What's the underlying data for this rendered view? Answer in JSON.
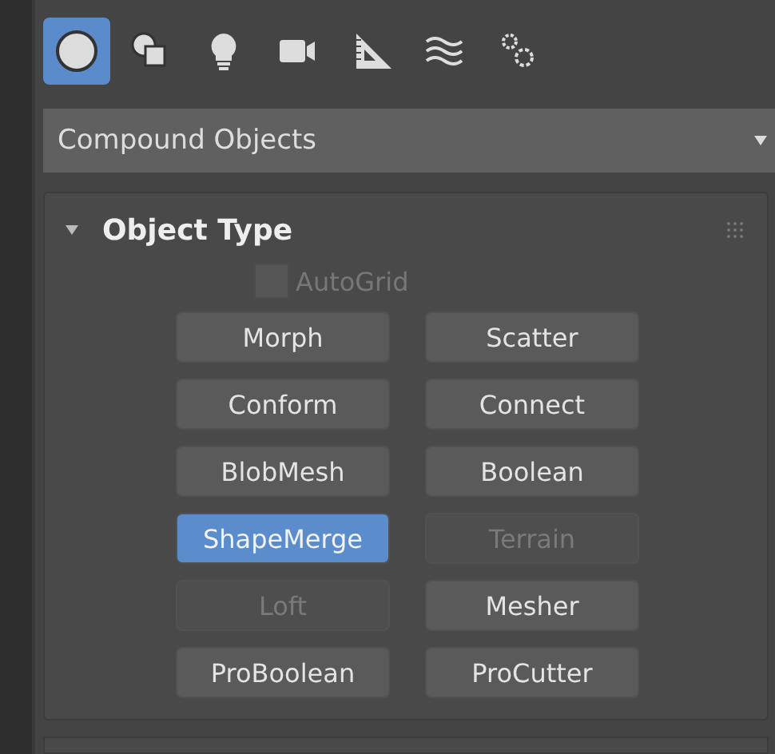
{
  "tabs": [
    {
      "kind": "geometry",
      "selected": true
    },
    {
      "kind": "shapes",
      "selected": false
    },
    {
      "kind": "lights",
      "selected": false
    },
    {
      "kind": "cameras",
      "selected": false
    },
    {
      "kind": "helpers",
      "selected": false
    },
    {
      "kind": "spacewarps",
      "selected": false
    },
    {
      "kind": "systems",
      "selected": false
    }
  ],
  "dropdown": {
    "value": "Compound Objects"
  },
  "rollout": {
    "title": "Object Type",
    "expanded": true,
    "autogrid": {
      "label": "AutoGrid",
      "checked": false,
      "disabled": true
    },
    "buttons": [
      {
        "label": "Morph",
        "selected": false,
        "disabled": false
      },
      {
        "label": "Scatter",
        "selected": false,
        "disabled": false
      },
      {
        "label": "Conform",
        "selected": false,
        "disabled": false
      },
      {
        "label": "Connect",
        "selected": false,
        "disabled": false
      },
      {
        "label": "BlobMesh",
        "selected": false,
        "disabled": false
      },
      {
        "label": "Boolean",
        "selected": false,
        "disabled": false
      },
      {
        "label": "ShapeMerge",
        "selected": true,
        "disabled": false
      },
      {
        "label": "Terrain",
        "selected": false,
        "disabled": true
      },
      {
        "label": "Loft",
        "selected": false,
        "disabled": true
      },
      {
        "label": "Mesher",
        "selected": false,
        "disabled": false
      },
      {
        "label": "ProBoolean",
        "selected": false,
        "disabled": false
      },
      {
        "label": "ProCutter",
        "selected": false,
        "disabled": false
      }
    ]
  }
}
